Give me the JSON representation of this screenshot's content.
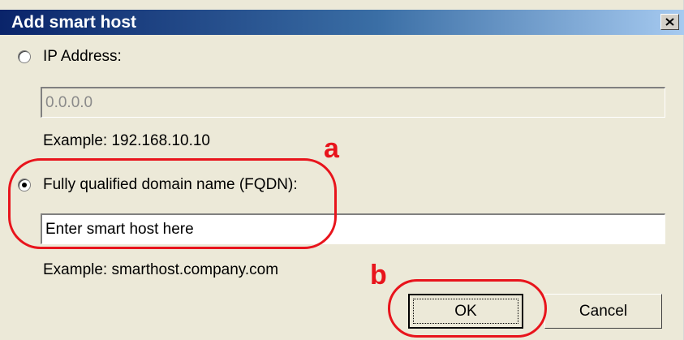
{
  "dialog": {
    "title": "Add smart host",
    "close_glyph": "x"
  },
  "ip_option": {
    "label": "IP Address:",
    "selected": false,
    "value": "0.0.0.0",
    "example": "Example: 192.168.10.10"
  },
  "fqdn_option": {
    "label": "Fully qualified domain name (FQDN):",
    "selected": true,
    "value": "Enter smart host here",
    "example": "Example: smarthost.company.com"
  },
  "buttons": {
    "ok_label": "OK",
    "cancel_label": "Cancel"
  },
  "annotations": {
    "letter_a": "a",
    "letter_b": "b",
    "color": "#e8141c"
  },
  "colors": {
    "titlebar_start": "#0a246a",
    "titlebar_end": "#a6caf0",
    "dialog_bg": "#ece9d8"
  },
  "icons": {
    "close": "close-x-icon"
  }
}
